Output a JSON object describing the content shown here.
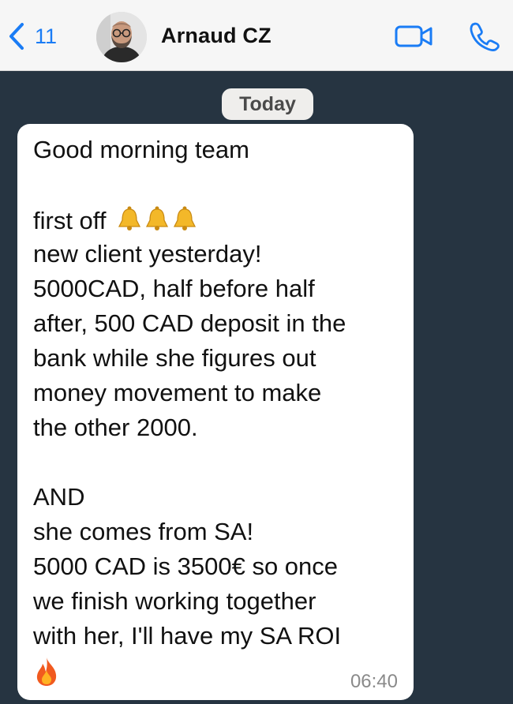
{
  "header": {
    "back_count": "11",
    "contact_name": "Arnaud CZ"
  },
  "chat": {
    "date_label": "Today",
    "message": {
      "lines": [
        "Good morning team",
        "first off",
        "new client yesterday!",
        "5000CAD, half before half",
        "after, 500 CAD deposit in the",
        "bank while she figures out",
        "money movement to make",
        "the other 2000.",
        "AND",
        "she comes from SA!",
        "5000 CAD is 3500€ so once",
        "we finish working together",
        "with her, I'll have my SA ROI"
      ],
      "emojis": [
        "bell-emoji",
        "bell-emoji",
        "bell-emoji",
        "fire-emoji"
      ],
      "time": "06:40"
    }
  },
  "colors": {
    "chat_background": "#263441",
    "header_background": "#f6f6f6",
    "accent": "#1a7cf5",
    "bubble": "#ffffff"
  }
}
